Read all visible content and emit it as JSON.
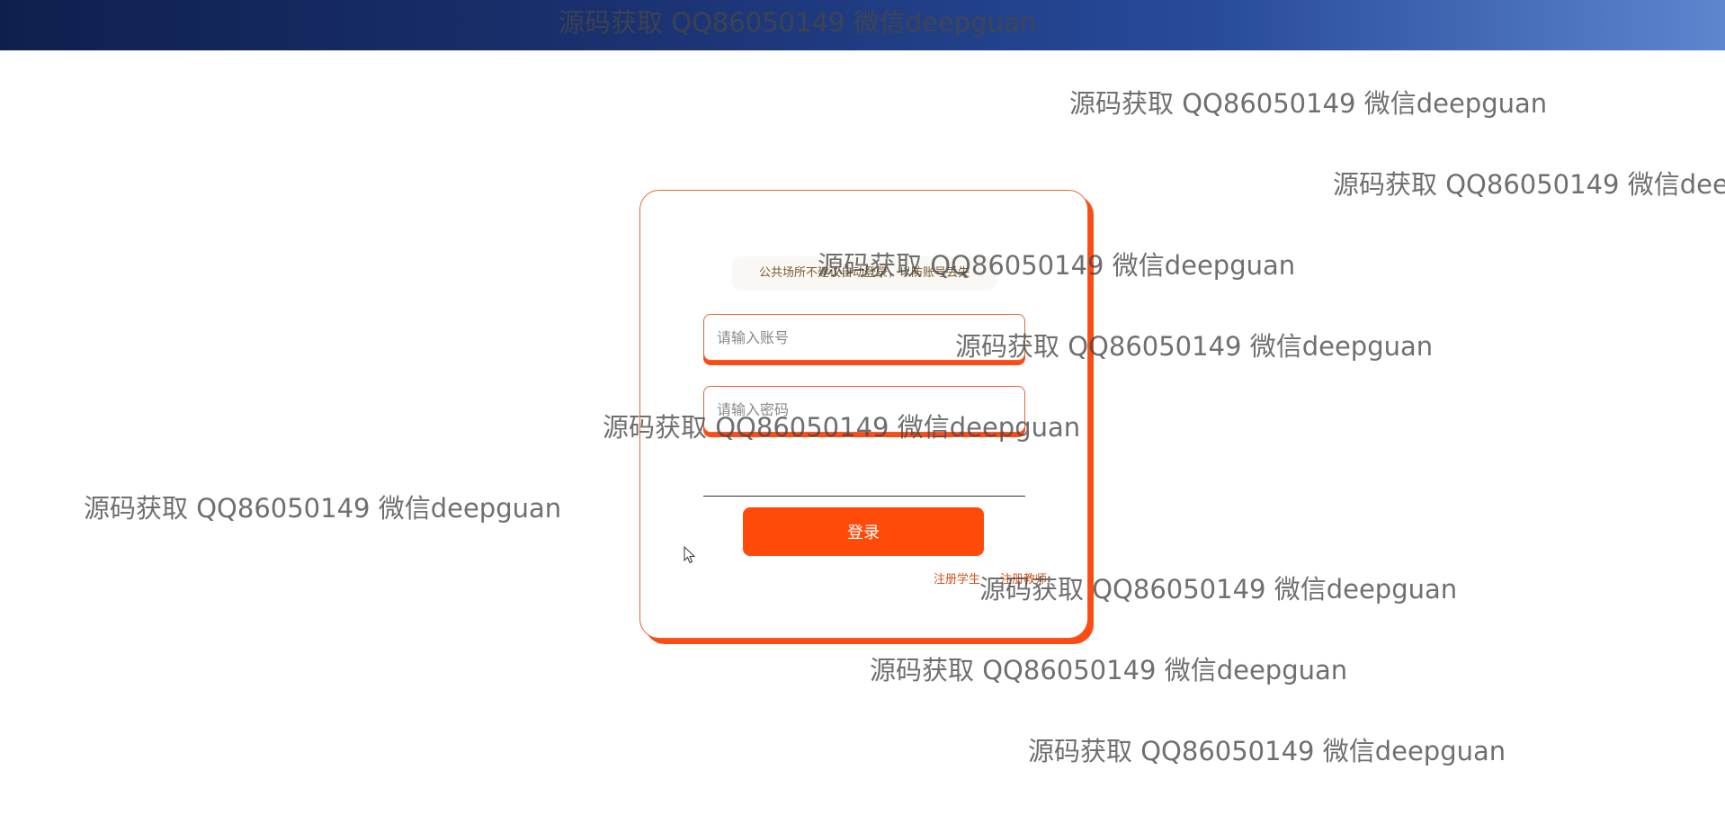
{
  "login": {
    "notice": "公共场所不建议自动登录，以防账号丢失",
    "username_placeholder": "请输入账号",
    "password_placeholder": "请输入密码",
    "login_button": "登录",
    "register_student": "注册学生",
    "register_teacher": "注册教师"
  },
  "watermark": {
    "text": "源码获取 QQ86050149 微信deepguan"
  },
  "colors": {
    "accent": "#ff4a0a",
    "header_gradient_start": "#0f1f4d",
    "header_gradient_end": "#5d86cf"
  }
}
